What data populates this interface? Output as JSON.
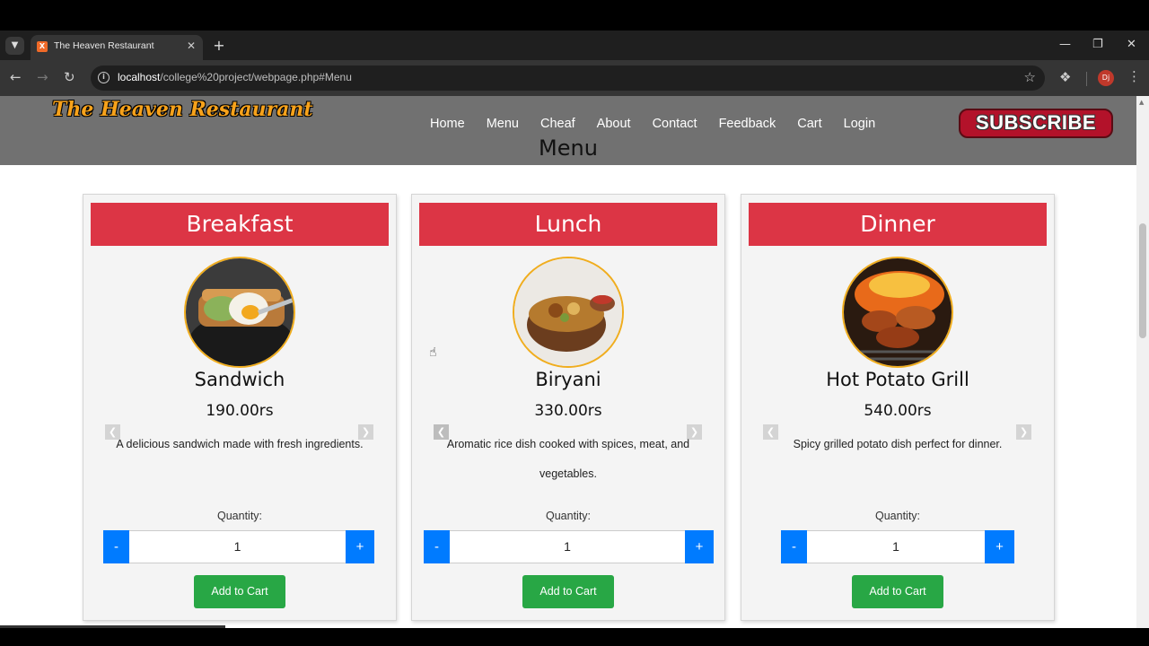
{
  "browser": {
    "tab_title": "The Heaven Restaurant",
    "url_host": "localhost",
    "url_path": "/college%20project/webpage.php#Menu",
    "profile_initials": "Dj"
  },
  "site": {
    "brand": "The Heaven Restaurant",
    "nav": [
      "Home",
      "Menu",
      "Cheaf",
      "About",
      "Contact",
      "Feedback",
      "Cart",
      "Login"
    ],
    "subscribe_label": "SUBSCRIBE",
    "section_heading": "Menu"
  },
  "cards": [
    {
      "header": "Breakfast",
      "dish": "Sandwich",
      "price": "190.00rs",
      "description": "A delicious sandwich made with fresh ingredients.",
      "quantity_label": "Quantity:",
      "minus_label": "-",
      "quantity_value": "1",
      "plus_label": "+",
      "add_label": "Add to Cart"
    },
    {
      "header": "Lunch",
      "dish": "Biryani",
      "price": "330.00rs",
      "description": "Aromatic rice dish cooked with spices, meat, and vegetables.",
      "quantity_label": "Quantity:",
      "minus_label": "-",
      "quantity_value": "1",
      "plus_label": "+",
      "add_label": "Add to Cart"
    },
    {
      "header": "Dinner",
      "dish": "Hot Potato Grill",
      "price": "540.00rs",
      "description": "Spicy grilled potato dish perfect for dinner.",
      "quantity_label": "Quantity:",
      "minus_label": "-",
      "quantity_value": "1",
      "plus_label": "+",
      "add_label": "Add to Cart"
    }
  ],
  "colors": {
    "header_bg": "#717171",
    "card_header": "#dc3545",
    "qty_button": "#007bff",
    "add_button": "#28a745",
    "brand_text": "#f7a21b"
  }
}
